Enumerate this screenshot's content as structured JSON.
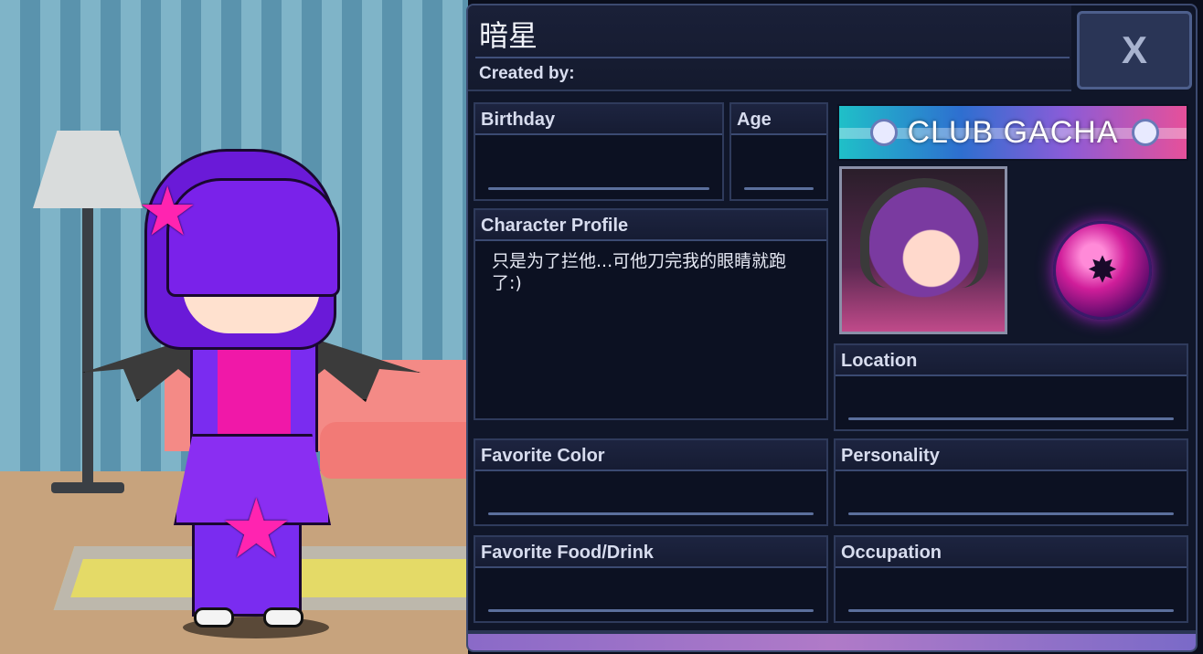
{
  "header": {
    "character_name": "暗星",
    "created_by_label": "Created by:"
  },
  "close_button": {
    "label": "X"
  },
  "logo": {
    "text": "CLUB GACHA"
  },
  "fields": {
    "birthday": {
      "label": "Birthday",
      "value": ""
    },
    "age": {
      "label": "Age",
      "value": ""
    },
    "character_profile": {
      "label": "Character Profile",
      "value": "只是为了拦他...可他刀完我的眼睛就跑了:)"
    },
    "favorite_color": {
      "label": "Favorite Color",
      "value": ""
    },
    "favorite_food": {
      "label": "Favorite Food/Drink",
      "value": ""
    },
    "location": {
      "label": "Location",
      "value": ""
    },
    "personality": {
      "label": "Personality",
      "value": ""
    },
    "occupation": {
      "label": "Occupation",
      "value": ""
    }
  },
  "icons": {
    "close": "close-icon",
    "gem": "dark-orb-icon",
    "portrait": "character-portrait"
  },
  "colors": {
    "panel_bg": "#101629",
    "label_text": "#d7dcee",
    "accent_pink": "#f018a8",
    "hair_purple": "#6a1ad8"
  }
}
